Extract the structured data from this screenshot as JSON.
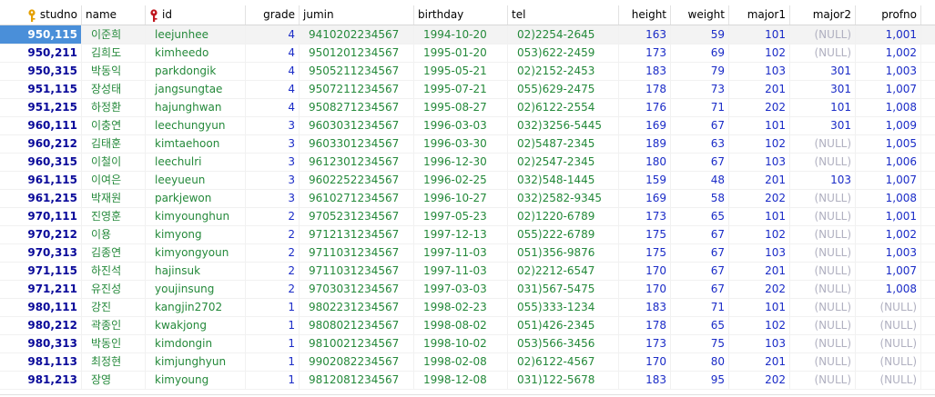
{
  "columns": [
    {
      "label": "studno",
      "key": true,
      "key_color": "#e5a000"
    },
    {
      "label": "name"
    },
    {
      "label": "id",
      "key": true,
      "key_color": "#c0161e"
    },
    {
      "label": "grade"
    },
    {
      "label": "jumin"
    },
    {
      "label": "birthday"
    },
    {
      "label": "tel"
    },
    {
      "label": "height"
    },
    {
      "label": "weight"
    },
    {
      "label": "major1"
    },
    {
      "label": "major2"
    },
    {
      "label": "profno"
    }
  ],
  "null_text": "(NULL)",
  "selected_row": 0,
  "rows": [
    [
      "950,115",
      "이준희",
      "leejunhee",
      "4",
      "9410202234567",
      "1994-10-20",
      "02)2254-2645",
      "163",
      "59",
      "101",
      "(NULL)",
      "1,001"
    ],
    [
      "950,211",
      "김희도",
      "kimheedo",
      "4",
      "9501201234567",
      "1995-01-20",
      "053)622-2459",
      "173",
      "69",
      "102",
      "(NULL)",
      "1,002"
    ],
    [
      "950,315",
      "박동익",
      "parkdongik",
      "4",
      "9505211234567",
      "1995-05-21",
      "02)2152-2453",
      "183",
      "79",
      "103",
      "301",
      "1,003"
    ],
    [
      "951,115",
      "장성태",
      "jangsungtae",
      "4",
      "9507211234567",
      "1995-07-21",
      "055)629-2475",
      "178",
      "73",
      "201",
      "301",
      "1,007"
    ],
    [
      "951,215",
      "하정환",
      "hajunghwan",
      "4",
      "9508271234567",
      "1995-08-27",
      "02)6122-2554",
      "176",
      "71",
      "202",
      "101",
      "1,008"
    ],
    [
      "960,111",
      "이충연",
      "leechungyun",
      "3",
      "9603031234567",
      "1996-03-03",
      "032)3256-5445",
      "169",
      "67",
      "101",
      "301",
      "1,009"
    ],
    [
      "960,212",
      "김태훈",
      "kimtaehoon",
      "3",
      "9603301234567",
      "1996-03-30",
      "02)5487-2345",
      "189",
      "63",
      "102",
      "(NULL)",
      "1,005"
    ],
    [
      "960,315",
      "이철이",
      "leechulri",
      "3",
      "9612301234567",
      "1996-12-30",
      "02)2547-2345",
      "180",
      "67",
      "103",
      "(NULL)",
      "1,006"
    ],
    [
      "961,115",
      "이여은",
      "leeyueun",
      "3",
      "9602252234567",
      "1996-02-25",
      "032)548-1445",
      "159",
      "48",
      "201",
      "103",
      "1,007"
    ],
    [
      "961,215",
      "박재원",
      "parkjewon",
      "3",
      "9610271234567",
      "1996-10-27",
      "032)2582-9345",
      "169",
      "58",
      "202",
      "(NULL)",
      "1,008"
    ],
    [
      "970,111",
      "진영훈",
      "kimyounghun",
      "2",
      "9705231234567",
      "1997-05-23",
      "02)1220-6789",
      "173",
      "65",
      "101",
      "(NULL)",
      "1,001"
    ],
    [
      "970,212",
      "이용",
      "kimyong",
      "2",
      "9712131234567",
      "1997-12-13",
      "055)222-6789",
      "175",
      "67",
      "102",
      "(NULL)",
      "1,002"
    ],
    [
      "970,313",
      "김종연",
      "kimyongyoun",
      "2",
      "9711031234567",
      "1997-11-03",
      "051)356-9876",
      "175",
      "67",
      "103",
      "(NULL)",
      "1,003"
    ],
    [
      "971,115",
      "하진석",
      "hajinsuk",
      "2",
      "9711031234567",
      "1997-11-03",
      "02)2212-6547",
      "170",
      "67",
      "201",
      "(NULL)",
      "1,007"
    ],
    [
      "971,211",
      "유진성",
      "youjinsung",
      "2",
      "9703031234567",
      "1997-03-03",
      "031)567-5475",
      "170",
      "67",
      "202",
      "(NULL)",
      "1,008"
    ],
    [
      "980,111",
      "강진",
      "kangjin2702",
      "1",
      "9802231234567",
      "1998-02-23",
      "055)333-1234",
      "183",
      "71",
      "101",
      "(NULL)",
      "(NULL)"
    ],
    [
      "980,212",
      "곽종인",
      "kwakjong",
      "1",
      "9808021234567",
      "1998-08-02",
      "051)426-2345",
      "178",
      "65",
      "102",
      "(NULL)",
      "(NULL)"
    ],
    [
      "980,313",
      "박동인",
      "kimdongin",
      "1",
      "9810021234567",
      "1998-10-02",
      "053)566-3456",
      "173",
      "75",
      "103",
      "(NULL)",
      "(NULL)"
    ],
    [
      "981,113",
      "최정현",
      "kimjunghyun",
      "1",
      "9902082234567",
      "1998-02-08",
      "02)6122-4567",
      "170",
      "80",
      "201",
      "(NULL)",
      "(NULL)"
    ],
    [
      "981,213",
      "장영",
      "kimyoung",
      "1",
      "9812081234567",
      "1998-12-08",
      "031)122-5678",
      "183",
      "95",
      "202",
      "(NULL)",
      "(NULL)"
    ]
  ]
}
